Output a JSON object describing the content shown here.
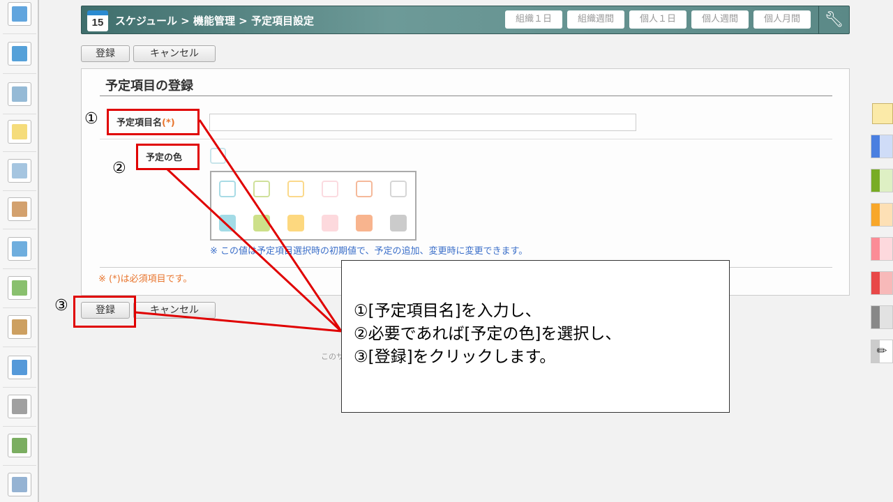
{
  "header": {
    "calendar_day": "15",
    "breadcrumb": "スケジュール > 機能管理 > 予定項目設定",
    "views": [
      "組織１日",
      "組織週間",
      "個人１日",
      "個人週間",
      "個人月間"
    ],
    "settings_icon": "wrench-icon"
  },
  "toolbar": {
    "register": "登録",
    "cancel": "キャンセル"
  },
  "form": {
    "title": "予定項目の登録",
    "name_label": "予定項目名",
    "required_mark": "(*)",
    "name_value": "",
    "color_label": "予定の色",
    "color_note": "※ この値は予定項目選択時の初期値で、予定の追加、変更時に変更できます。",
    "required_note": "※ (*)は必須項目です。",
    "outline_colors": [
      "#a8dbe5",
      "#cfe09a",
      "#fbd98b",
      "#fbdbe0",
      "#f5b99a",
      "#d6d6d6"
    ],
    "fill_colors": [
      "#a3dbe6",
      "#cde08a",
      "#fdd87f",
      "#fdd9dd",
      "#f8b48e",
      "#cbcbcb"
    ]
  },
  "footer": {
    "text": "このサ"
  },
  "annotations": {
    "n1": "①",
    "n2": "②",
    "n3": "③",
    "lines": [
      "①[予定項目名]を入力し、",
      "②必要であれば[予定の色]を選択し、",
      "③[登録]をクリックします。"
    ]
  },
  "right_colors": [
    [
      "#4a7fe0",
      "#cfdcf7"
    ],
    [
      "#78ac25",
      "#def0c4"
    ],
    [
      "#f8a72a",
      "#fde0b5"
    ],
    [
      "#fb8c96",
      "#fdd9dd"
    ],
    [
      "#e84848",
      "#f7b9b9"
    ],
    [
      "#888888",
      "#e2e2e2"
    ]
  ]
}
